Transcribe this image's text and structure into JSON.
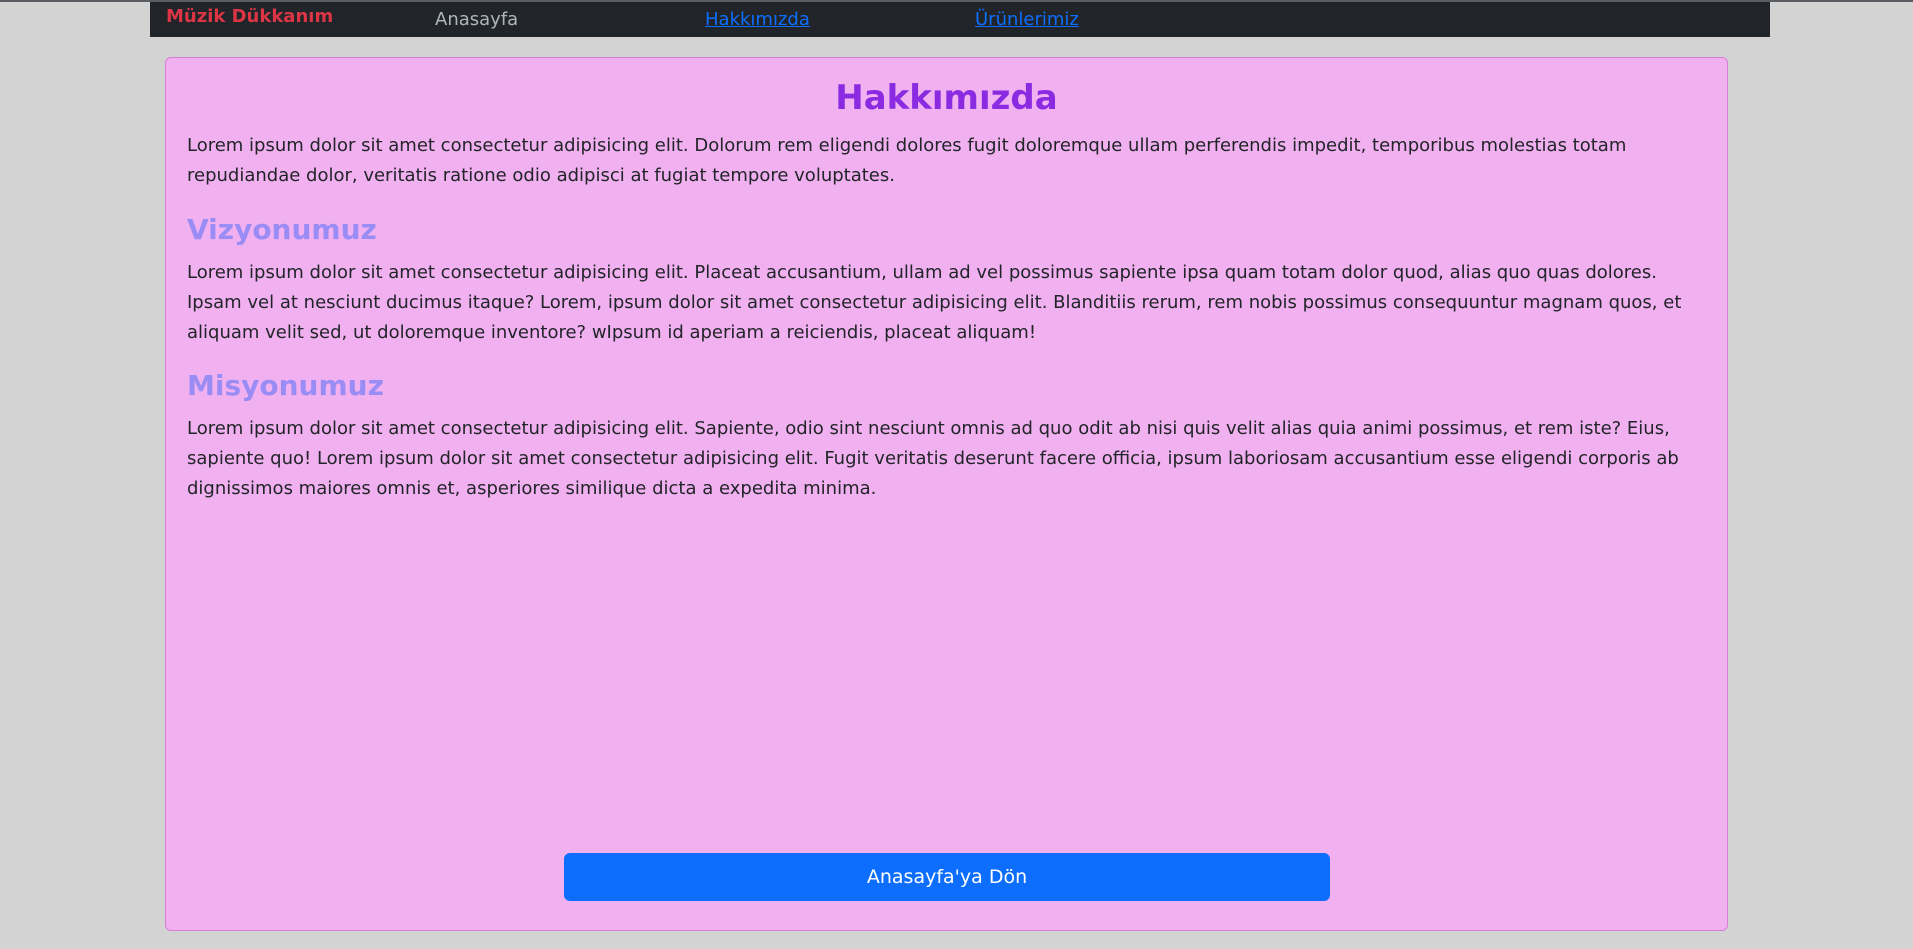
{
  "navbar": {
    "brand": "Müzik Dükkanım",
    "links": [
      {
        "label": "Anasayfa"
      },
      {
        "label": "Hakkımızda"
      },
      {
        "label": "Ürünlerimiz"
      }
    ]
  },
  "content": {
    "title": "Hakkımızda",
    "intro": "Lorem ipsum dolor sit amet consectetur adipisicing elit. Dolorum rem eligendi dolores fugit doloremque ullam perferendis impedit, temporibus molestias totam repudiandae dolor, veritatis ratione odio adipisci at fugiat tempore voluptates.",
    "vision_heading": "Vizyonumuz",
    "vision_text": "Lorem ipsum dolor sit amet consectetur adipisicing elit. Placeat accusantium, ullam ad vel possimus sapiente ipsa quam totam dolor quod, alias quo quas dolores. Ipsam vel at nesciunt ducimus itaque? Lorem, ipsum dolor sit amet consectetur adipisicing elit. Blanditiis rerum, rem nobis possimus consequuntur magnam quos, et aliquam velit sed, ut doloremque inventore? wIpsum id aperiam a reiciendis, placeat aliquam!",
    "mission_heading": "Misyonumuz",
    "mission_text": "Lorem ipsum dolor sit amet consectetur adipisicing elit. Sapiente, odio sint nesciunt omnis ad quo odit ab nisi quis velit alias quia animi possimus, et rem iste? Eius, sapiente quo! Lorem ipsum dolor sit amet consectetur adipisicing elit. Fugit veritatis deserunt facere officia, ipsum laboriosam accusantium esse eligendi corporis ab dignissimos maiores omnis et, asperiores similique dicta a expedita minima.",
    "back_button": "Anasayfa'ya Dön"
  },
  "colors": {
    "page_background": "#d3d3d3",
    "navbar_background": "#212529",
    "brand": "#dc3545",
    "card_background": "#f1b0ef",
    "title": "#8a2be2",
    "subheading": "#9a8cf5",
    "link": "#0d6efd",
    "button": "#0d6efd"
  }
}
